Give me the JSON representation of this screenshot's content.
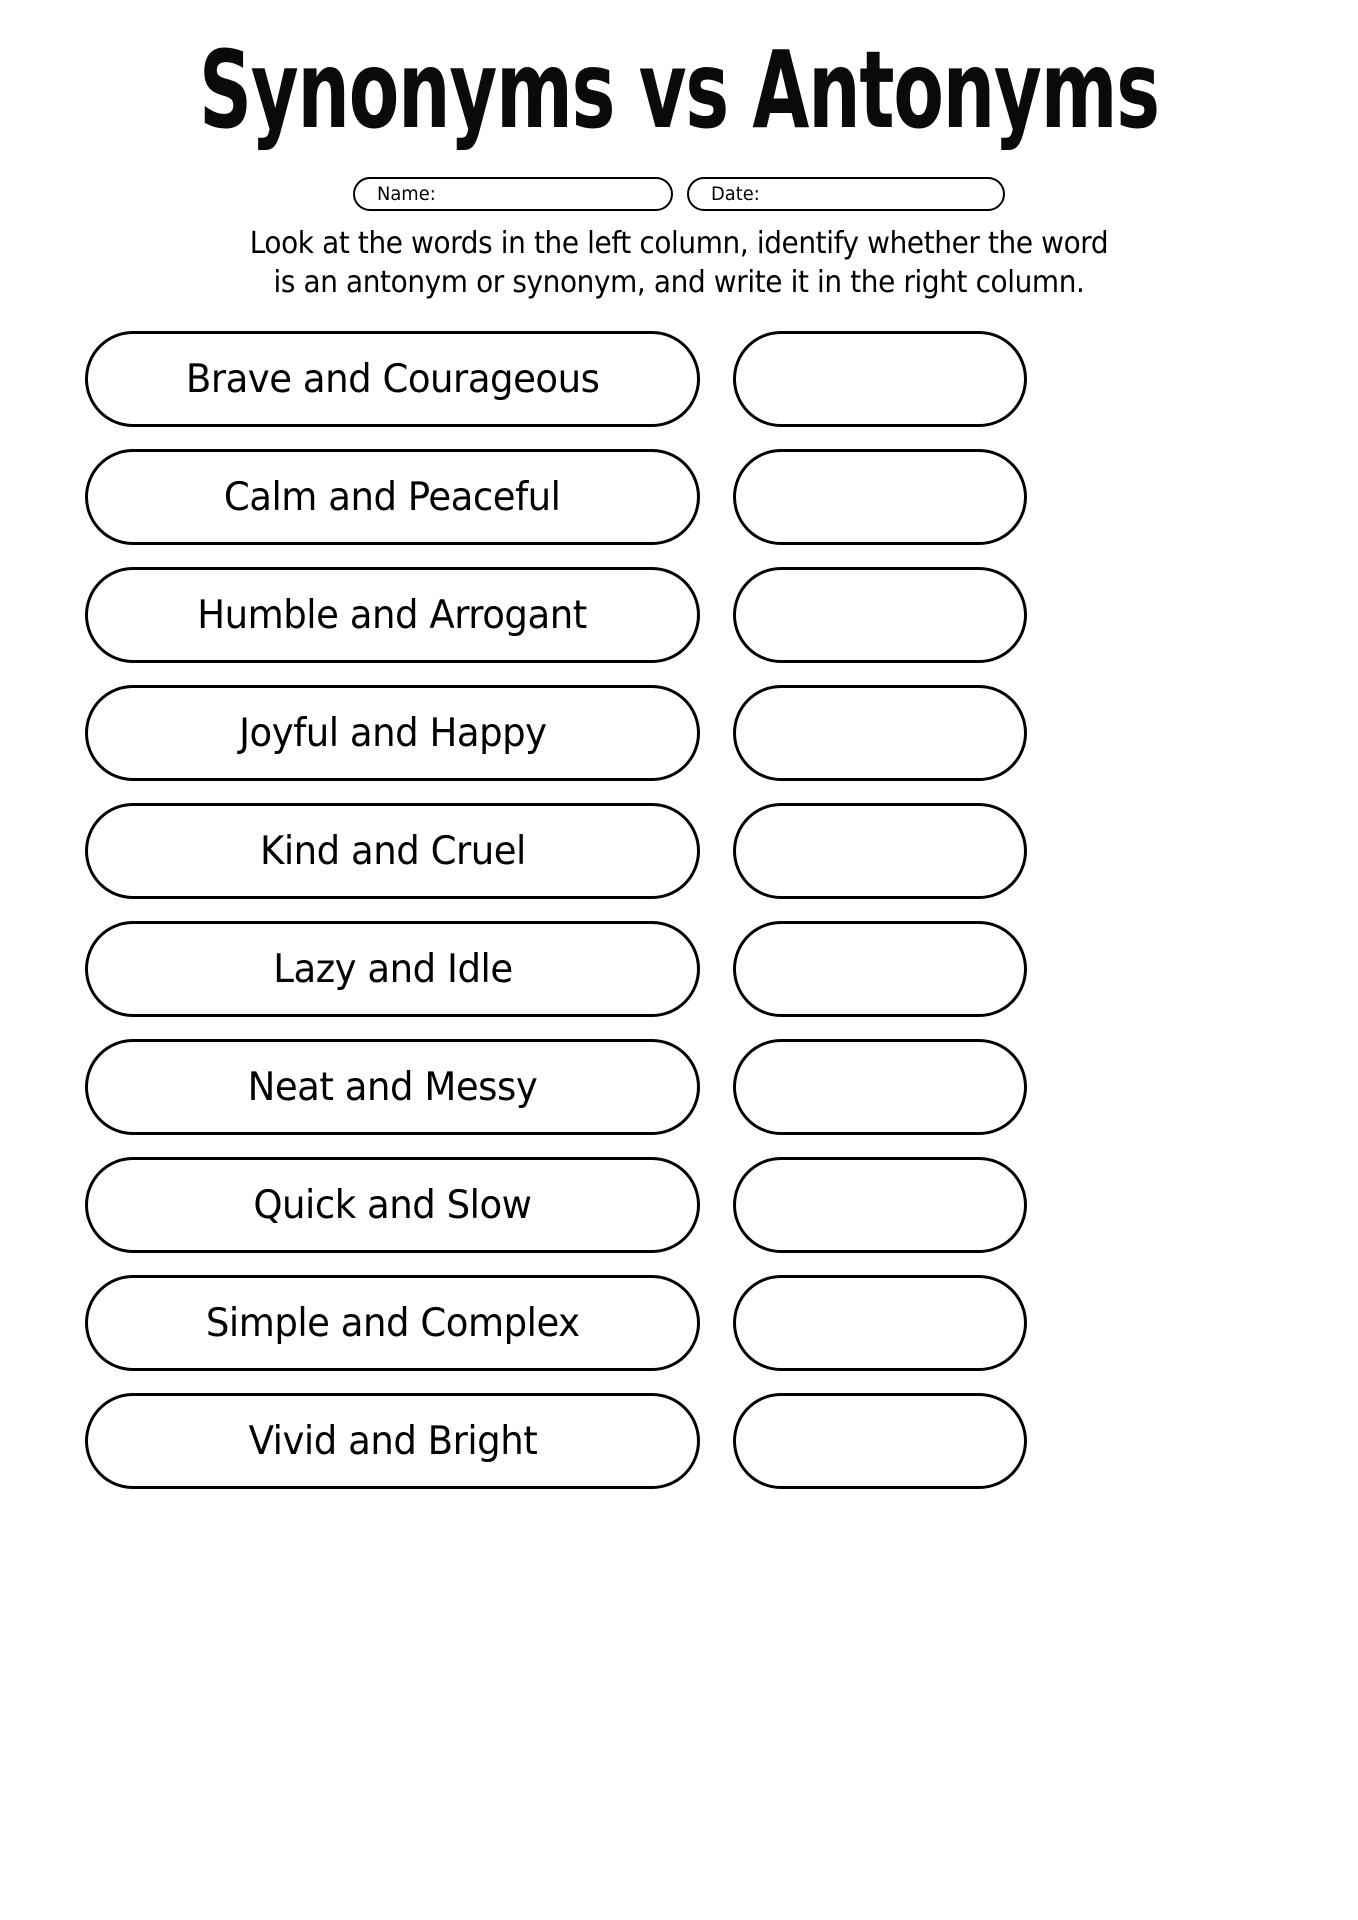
{
  "worksheet": {
    "title": "Synonyms vs Antonyms",
    "meta_fields": [
      {
        "id": "name",
        "label": "Name:",
        "value": ""
      },
      {
        "id": "date",
        "label": "Date:",
        "value": ""
      }
    ],
    "instructions": {
      "line1": "Look at the words in the left column, identify whether the word",
      "line2": "is an antonym or synonym, and write it in the right column."
    },
    "columns": {
      "left_header": "",
      "right_header": ""
    },
    "rows": [
      {
        "word_pair": "Brave and Courageous",
        "answer": ""
      },
      {
        "word_pair": "Calm and Peaceful",
        "answer": ""
      },
      {
        "word_pair": "Humble and Arrogant",
        "answer": ""
      },
      {
        "word_pair": "Joyful and Happy",
        "answer": ""
      },
      {
        "word_pair": "Kind and Cruel",
        "answer": ""
      },
      {
        "word_pair": "Lazy and Idle",
        "answer": ""
      },
      {
        "word_pair": "Neat and Messy",
        "answer": ""
      },
      {
        "word_pair": "Quick and Slow",
        "answer": ""
      },
      {
        "word_pair": "Simple and Complex",
        "answer": ""
      },
      {
        "word_pair": "Vivid and Bright",
        "answer": ""
      }
    ],
    "colors": {
      "ink": "#000000",
      "paper": "#ffffff"
    }
  }
}
